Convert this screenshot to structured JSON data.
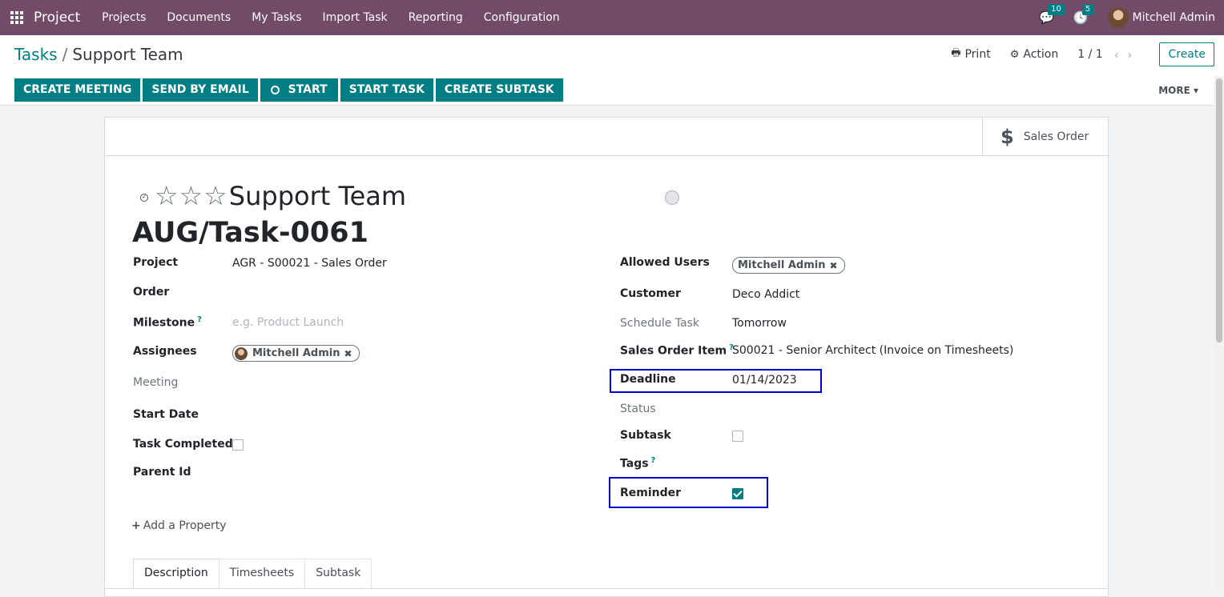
{
  "topnav": {
    "app_name": "Project",
    "menu": [
      "Projects",
      "Documents",
      "My Tasks",
      "Import Task",
      "Reporting",
      "Configuration"
    ],
    "messages_count": "10",
    "activities_count": "5",
    "user_name": "Mitchell Admin"
  },
  "breadcrumb": {
    "parent": "Tasks",
    "separator": "/",
    "current": "Support Team"
  },
  "control": {
    "print_label": "Print",
    "action_label": "Action",
    "pager": "1 / 1",
    "create_label": "Create"
  },
  "statusbar": {
    "buttons": [
      "CREATE MEETING",
      "SEND BY EMAIL",
      "START",
      "START TASK",
      "CREATE SUBTASK"
    ],
    "more_label": "MORE"
  },
  "smart_button": {
    "icon": "dollar-icon",
    "label": "Sales Order"
  },
  "record": {
    "name": "Support Team",
    "sequence": "AUG/Task-0061"
  },
  "left_fields": {
    "project": {
      "label": "Project",
      "value": "AGR - S00021 - Sales Order"
    },
    "order": {
      "label": "Order",
      "value": ""
    },
    "milestone": {
      "label": "Milestone",
      "help": "?",
      "placeholder": "e.g. Product Launch"
    },
    "assignees": {
      "label": "Assignees",
      "value": "Mitchell Admin"
    },
    "meeting": {
      "label": "Meeting"
    },
    "start_date": {
      "label": "Start Date"
    },
    "task_completed": {
      "label": "Task Completed",
      "checked": false
    },
    "parent_id": {
      "label": "Parent Id"
    }
  },
  "right_fields": {
    "allowed_users": {
      "label": "Allowed Users",
      "value": "Mitchell Admin"
    },
    "customer": {
      "label": "Customer",
      "value": "Deco Addict"
    },
    "schedule_task": {
      "label": "Schedule Task",
      "value": "Tomorrow"
    },
    "sales_order_item": {
      "label": "Sales Order Item",
      "help": "?",
      "value": "S00021 - Senior Architect (Invoice on Timesheets)"
    },
    "deadline": {
      "label": "Deadline",
      "value": "01/14/2023"
    },
    "status": {
      "label": "Status"
    },
    "subtask": {
      "label": "Subtask",
      "checked": false
    },
    "tags": {
      "label": "Tags",
      "help": "?"
    },
    "reminder": {
      "label": "Reminder",
      "checked": true
    }
  },
  "add_property_label": "Add a Property",
  "tabs": [
    "Description",
    "Timesheets",
    "Subtask"
  ],
  "colors": {
    "brand": "#714b67",
    "accent": "#017e84",
    "highlight": "#0000cc"
  }
}
